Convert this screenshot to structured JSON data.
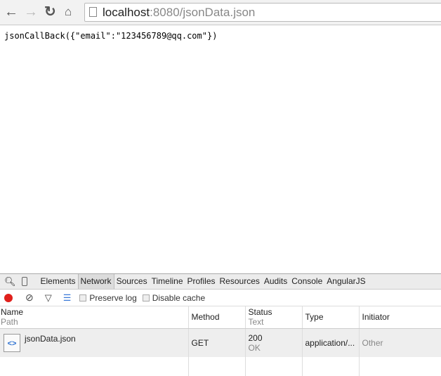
{
  "browser": {
    "url_host": "localhost",
    "url_rest": ":8080/jsonData.json",
    "icons": [
      "back-arrow",
      "forward-arrow",
      "reload",
      "home",
      "page"
    ]
  },
  "page": {
    "text": "jsonCallBack({\"email\":\"123456789@qq.com\"})"
  },
  "devtools": {
    "tabs": [
      "Elements",
      "Network",
      "Sources",
      "Timeline",
      "Profiles",
      "Resources",
      "Audits",
      "Console",
      "AngularJS"
    ],
    "active_tab": "Network",
    "toolbar": {
      "preserve_log": "Preserve log",
      "disable_cache": "Disable cache",
      "preserve_log_checked": false,
      "disable_cache_checked": false,
      "record_color": "#e0201c"
    },
    "columns": {
      "name": "Name",
      "path": "Path",
      "method": "Method",
      "status": "Status",
      "text": "Text",
      "type": "Type",
      "initiator": "Initiator"
    },
    "rows": [
      {
        "name": "jsonData.json",
        "method": "GET",
        "status": "200",
        "status_text": "OK",
        "type": "application/...",
        "initiator": "Other"
      }
    ]
  }
}
